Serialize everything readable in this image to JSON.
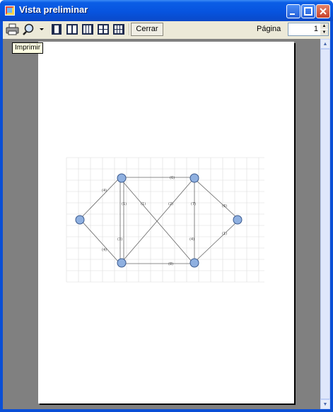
{
  "window": {
    "title": "Vista preliminar"
  },
  "toolbar": {
    "print_icon": "printer-icon",
    "zoom_icon": "magnifier-icon",
    "zoom_dropdown_icon": "chevron-down-icon",
    "layouts": [
      "one-page-icon",
      "two-pages-icon",
      "three-pages-icon",
      "four-pages-icon",
      "six-pages-icon"
    ],
    "close_label": "Cerrar",
    "page_label": "Página",
    "page_value": "1"
  },
  "tooltip": {
    "text": "Imprimir"
  },
  "diagram": {
    "edge_labels": [
      "(4)",
      "(4)",
      "(6)",
      "(1)",
      "(1)",
      "(2)",
      "(7)",
      "(6)",
      "(3)",
      "(4)",
      "(8)",
      "(1)"
    ]
  },
  "colors": {
    "node_fill": "#8fb0e0",
    "node_stroke": "#3b5a8e",
    "grid": "#d9d9d9",
    "preview_bg": "#808080",
    "titlebar": "#0754df"
  }
}
